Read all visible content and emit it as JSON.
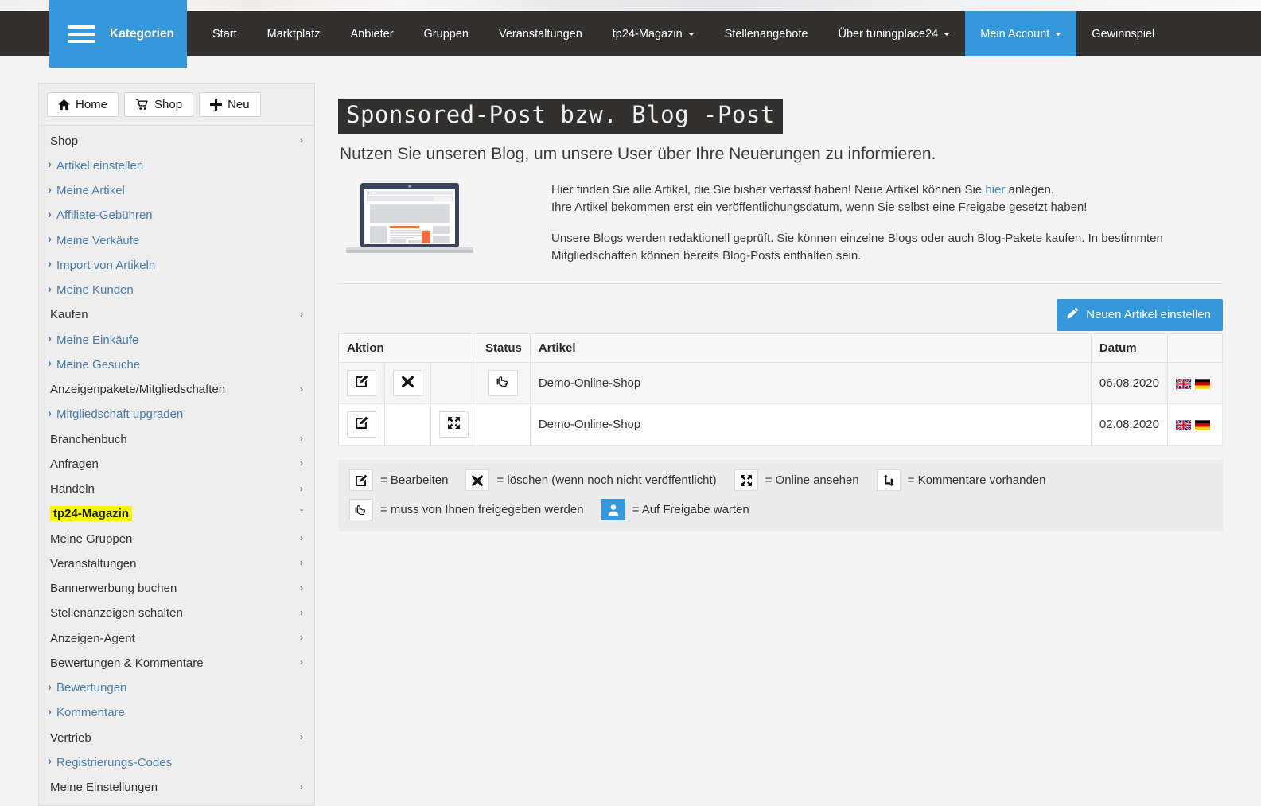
{
  "nav": {
    "categories_label": "Kategorien",
    "links": [
      {
        "label": "Start",
        "caret": false,
        "active": false
      },
      {
        "label": "Marktplatz",
        "caret": false,
        "active": false
      },
      {
        "label": "Anbieter",
        "caret": false,
        "active": false
      },
      {
        "label": "Gruppen",
        "caret": false,
        "active": false
      },
      {
        "label": "Veranstaltungen",
        "caret": false,
        "active": false
      },
      {
        "label": "tp24-Magazin",
        "caret": true,
        "active": false
      },
      {
        "label": "Stellenangebote",
        "caret": false,
        "active": false
      },
      {
        "label": "Über tuningplace24",
        "caret": true,
        "active": false
      },
      {
        "label": "Mein Account",
        "caret": true,
        "active": true
      },
      {
        "label": "Gewinnspiel",
        "caret": false,
        "active": false
      }
    ]
  },
  "sidebar": {
    "buttons": [
      {
        "label": "Home",
        "icon": "home-icon"
      },
      {
        "label": "Shop",
        "icon": "cart-icon"
      },
      {
        "label": "Neu",
        "icon": "plus-icon"
      }
    ],
    "items": [
      {
        "label": "Shop",
        "type": "group",
        "chevron": "›"
      },
      {
        "label": "Artikel einstellen",
        "type": "link"
      },
      {
        "label": "Meine Artikel",
        "type": "link"
      },
      {
        "label": "Affiliate-Gebühren",
        "type": "link"
      },
      {
        "label": "Meine Verkäufe",
        "type": "link"
      },
      {
        "label": "Import von Artikeln",
        "type": "link"
      },
      {
        "label": "Meine Kunden",
        "type": "link"
      },
      {
        "label": "Kaufen",
        "type": "group",
        "chevron": "›"
      },
      {
        "label": "Meine Einkäufe",
        "type": "link"
      },
      {
        "label": "Meine Gesuche",
        "type": "link"
      },
      {
        "label": "Anzeigenpakete/Mitgliedschaften",
        "type": "group",
        "chevron": "›"
      },
      {
        "label": "Mitgliedschaft upgraden",
        "type": "link"
      },
      {
        "label": "Branchenbuch",
        "type": "group",
        "chevron": "›"
      },
      {
        "label": "Anfragen",
        "type": "group",
        "chevron": "›"
      },
      {
        "label": "Handeln",
        "type": "group",
        "chevron": "›"
      },
      {
        "label": "tp24-Magazin",
        "type": "group",
        "chevron": "ˇ",
        "highlighted": true
      },
      {
        "label": "Meine Gruppen",
        "type": "group",
        "chevron": "›"
      },
      {
        "label": "Veranstaltungen",
        "type": "group",
        "chevron": "›"
      },
      {
        "label": "Bannerwerbung buchen",
        "type": "group",
        "chevron": "›"
      },
      {
        "label": "Stellenanzeigen schalten",
        "type": "group",
        "chevron": "›"
      },
      {
        "label": "Anzeigen-Agent",
        "type": "group",
        "chevron": "›"
      },
      {
        "label": "Bewertungen & Kommentare",
        "type": "group",
        "chevron": "›"
      },
      {
        "label": "Bewertungen",
        "type": "link"
      },
      {
        "label": "Kommentare",
        "type": "link"
      },
      {
        "label": "Vertrieb",
        "type": "group",
        "chevron": "›"
      },
      {
        "label": "Registrierungs-Codes",
        "type": "link"
      },
      {
        "label": "Meine Einstellungen",
        "type": "group",
        "chevron": "›"
      }
    ]
  },
  "main": {
    "title": "Sponsored-Post bzw. Blog -Post",
    "subtitle": "Nutzen Sie unseren Blog, um unsere User über Ihre Neuerungen zu informieren.",
    "intro": {
      "p1_before_link": "Hier finden Sie alle Artikel, die Sie bisher verfasst haben! Neue Artikel können Sie ",
      "p1_link": "hier",
      "p1_after_link": " anlegen.",
      "p1_line2": "Ihre Artikel bekommen erst ein veröffentlichungsdatum, wenn Sie selbst eine Freigabe gesetzt haben!",
      "p2": "Unsere Blogs werden redaktionell geprüft. Sie können einzelne Blogs oder auch Blog-Pakete kaufen. In bestimmten Mitgliedschaften können bereits Blog-Posts enthalten sein."
    },
    "new_article_button": "Neuen Artikel einstellen",
    "table": {
      "headers": [
        "Aktion",
        "",
        "",
        "Status",
        "Artikel",
        "Datum",
        ""
      ],
      "rows": [
        {
          "actions": [
            "edit-icon",
            "delete-icon",
            ""
          ],
          "status": "pointing-hand-icon",
          "article": "Demo-Online-Shop",
          "date": "06.08.2020",
          "flags": [
            "uk-flag",
            "de-flag"
          ]
        },
        {
          "actions": [
            "edit-icon",
            "",
            "expand-icon"
          ],
          "status": "",
          "article": "Demo-Online-Shop",
          "date": "02.08.2020",
          "flags": [
            "uk-flag",
            "de-flag"
          ]
        }
      ]
    },
    "legend": {
      "row1": [
        {
          "icon": "edit-icon",
          "text": "= Bearbeiten"
        },
        {
          "icon": "delete-icon",
          "text": "= löschen (wenn noch nicht veröffentlicht)"
        },
        {
          "icon": "expand-icon",
          "text": "= Online ansehen"
        },
        {
          "icon": "comments-icon",
          "text": "= Kommentare vorhanden"
        }
      ],
      "row2": [
        {
          "icon": "pointing-hand-icon",
          "text": "= muss von Ihnen freigegeben werden"
        },
        {
          "icon": "user-icon",
          "text": "= Auf Freigabe warten",
          "blue": true
        }
      ]
    }
  },
  "colors": {
    "accent": "#3498db",
    "navbar": "#33312f",
    "highlight": "#f7f700",
    "link": "#4b7cad"
  }
}
